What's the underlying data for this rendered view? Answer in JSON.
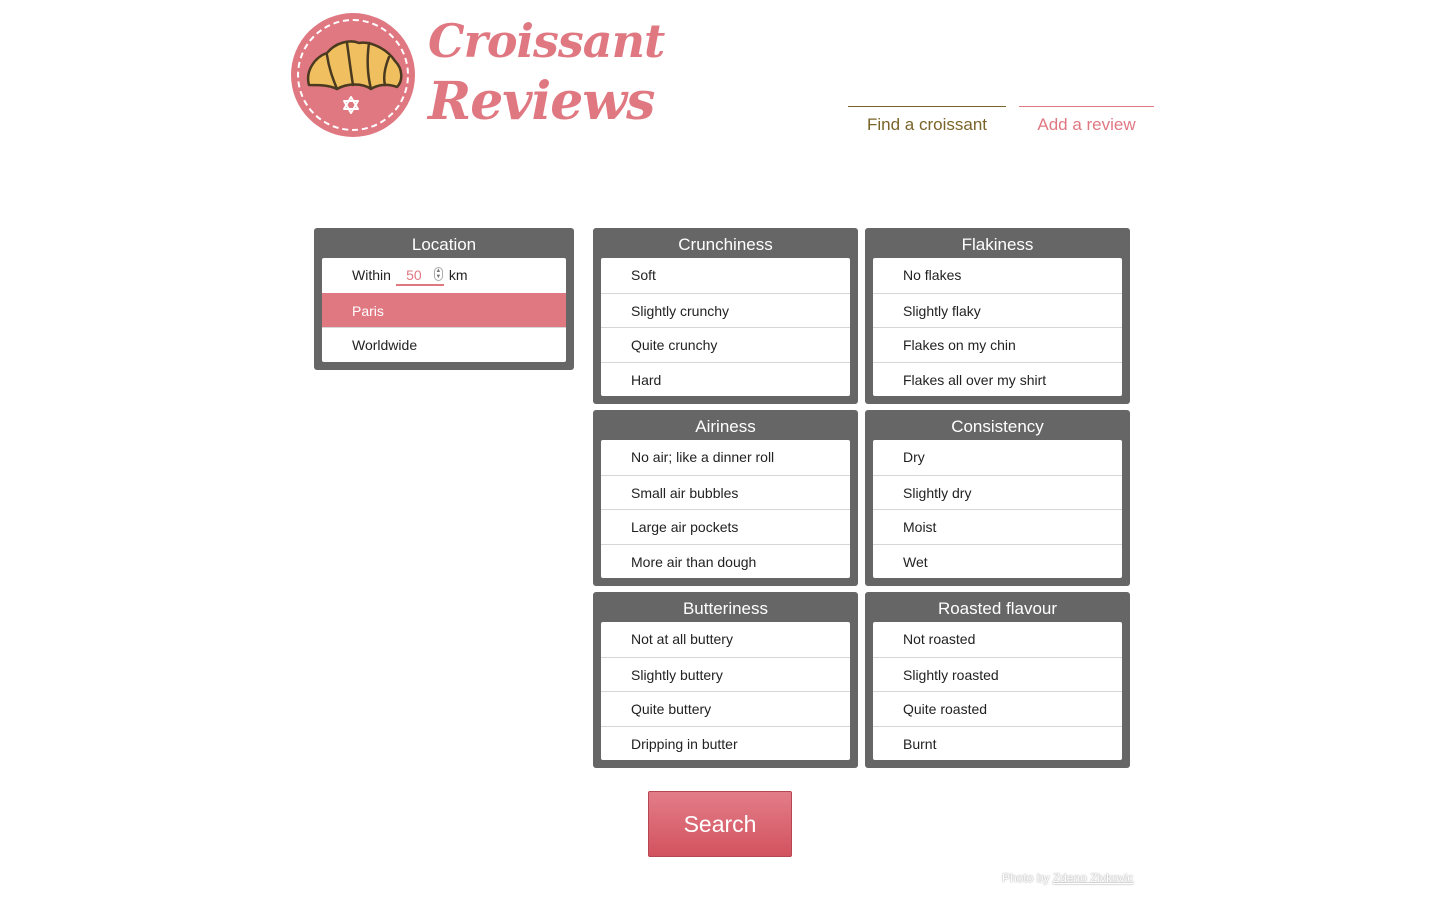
{
  "brand": {
    "line1": "Croissant",
    "line2": "Reviews",
    "accent_color": "#e07882",
    "pastry_color": "#f0c060"
  },
  "nav": {
    "find_label": "Find a croissant",
    "add_label": "Add a review"
  },
  "location": {
    "title": "Location",
    "within_label": "Within",
    "radius_value": "50",
    "radius_unit": "km",
    "options": [
      "Paris",
      "Worldwide"
    ],
    "selected": "Paris"
  },
  "filters": {
    "crunchiness": {
      "title": "Crunchiness",
      "options": [
        "Soft",
        "Slightly crunchy",
        "Quite crunchy",
        "Hard"
      ]
    },
    "flakiness": {
      "title": "Flakiness",
      "options": [
        "No flakes",
        "Slightly flaky",
        "Flakes on my chin",
        "Flakes all over my shirt"
      ]
    },
    "airiness": {
      "title": "Airiness",
      "options": [
        "No air; like a dinner roll",
        "Small air bubbles",
        "Large air pockets",
        "More air than dough"
      ]
    },
    "consistency": {
      "title": "Consistency",
      "options": [
        "Dry",
        "Slightly dry",
        "Moist",
        "Wet"
      ]
    },
    "butteriness": {
      "title": "Butteriness",
      "options": [
        "Not at all buttery",
        "Slightly buttery",
        "Quite buttery",
        "Dripping in butter"
      ]
    },
    "roasted": {
      "title": "Roasted flavour",
      "options": [
        "Not roasted",
        "Slightly roasted",
        "Quite roasted",
        "Burnt"
      ]
    }
  },
  "search": {
    "label": "Search"
  },
  "credit": {
    "prefix": "Photo by",
    "author": "Zdeno Zivkovic"
  }
}
